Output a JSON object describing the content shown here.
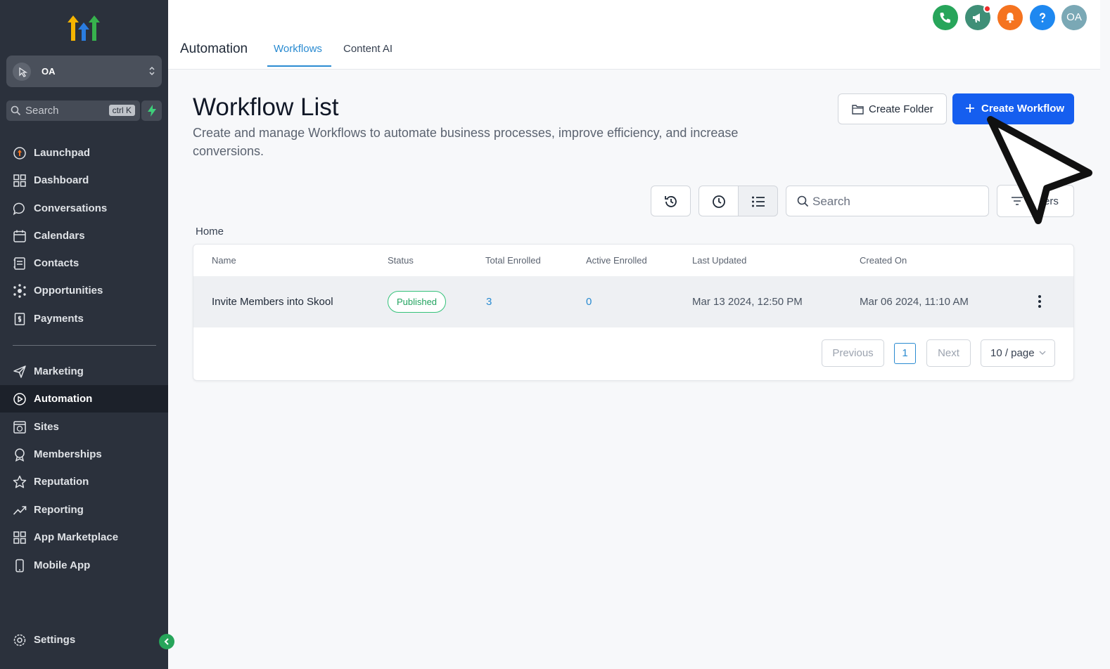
{
  "sidebar": {
    "account": {
      "name": "OA"
    },
    "search": {
      "placeholder": "Search",
      "shortcut": "ctrl K"
    },
    "items": [
      {
        "label": "Launchpad",
        "icon": "launchpad-icon"
      },
      {
        "label": "Dashboard",
        "icon": "dashboard-icon"
      },
      {
        "label": "Conversations",
        "icon": "chat-icon"
      },
      {
        "label": "Calendars",
        "icon": "calendar-icon"
      },
      {
        "label": "Contacts",
        "icon": "contacts-icon"
      },
      {
        "label": "Opportunities",
        "icon": "opportunities-icon"
      },
      {
        "label": "Payments",
        "icon": "payments-icon"
      },
      {
        "label": "Marketing",
        "icon": "send-icon"
      },
      {
        "label": "Automation",
        "icon": "automation-icon",
        "active": true
      },
      {
        "label": "Sites",
        "icon": "sites-icon"
      },
      {
        "label": "Memberships",
        "icon": "badge-icon"
      },
      {
        "label": "Reputation",
        "icon": "star-icon"
      },
      {
        "label": "Reporting",
        "icon": "trend-icon"
      },
      {
        "label": "App Marketplace",
        "icon": "grid-icon"
      },
      {
        "label": "Mobile App",
        "icon": "mobile-icon"
      }
    ],
    "settings_label": "Settings"
  },
  "header": {
    "module_title": "Automation",
    "tabs": [
      {
        "label": "Workflows",
        "active": true
      },
      {
        "label": "Content AI"
      }
    ],
    "avatar_initials": "OA"
  },
  "colors": {
    "accent": "#155eef",
    "link": "#2a8bd1",
    "sidebar_bg": "#2b313c",
    "published": "#22a35f"
  },
  "main": {
    "title": "Workflow List",
    "description": "Create and manage Workflows to automate business processes, improve efficiency, and increase conversions.",
    "create_folder_label": "Create Folder",
    "create_workflow_label": "Create Workflow",
    "search_placeholder": "Search",
    "filters_label": "Filters",
    "breadcrumb": "Home",
    "table": {
      "columns": [
        "Name",
        "Status",
        "Total Enrolled",
        "Active Enrolled",
        "Last Updated",
        "Created On"
      ],
      "rows": [
        {
          "name": "Invite Members into Skool",
          "status": "Published",
          "total_enrolled": "3",
          "active_enrolled": "0",
          "last_updated": "Mar 13 2024, 12:50 PM",
          "created_on": "Mar 06 2024, 11:10 AM"
        }
      ]
    },
    "pagination": {
      "previous": "Previous",
      "current": "1",
      "next": "Next",
      "page_size": "10 / page"
    }
  }
}
